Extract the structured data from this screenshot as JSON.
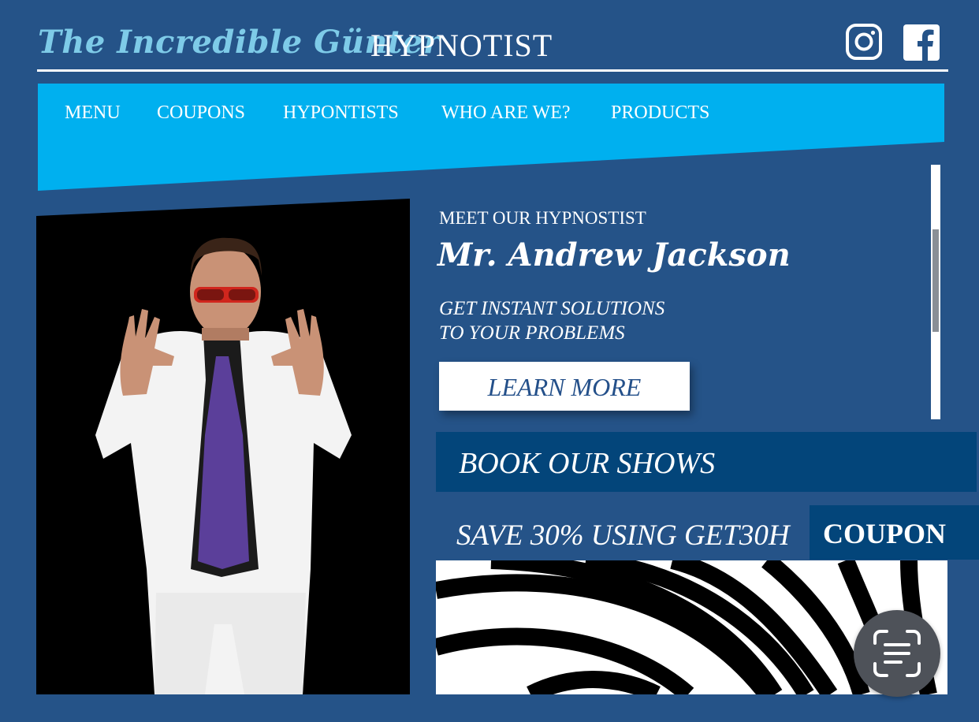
{
  "header": {
    "logo_script": "The Incredible Günter",
    "logo_word": "HYPNOTIST",
    "social": [
      "instagram-icon",
      "facebook-icon"
    ]
  },
  "nav": {
    "items": [
      "MENU",
      "COUPONS",
      "HYPONTISTS",
      "WHO ARE WE?",
      "PRODUCTS"
    ]
  },
  "hero": {
    "kicker": "MEET OUR HYPNOSTIST",
    "name": "Mr. Andrew Jackson",
    "tagline_1": "GET INSTANT SOLUTIONS",
    "tagline_2": "TO YOUR PROBLEMS",
    "cta": "LEARN MORE"
  },
  "shows": {
    "title": "BOOK OUR SHOWS"
  },
  "coupon": {
    "text": "SAVE 30% USING GET30H",
    "label": "COUPON"
  },
  "colors": {
    "background": "#255388",
    "nav_band": "#00b0ef",
    "dark_band": "#03457a",
    "logo_accent": "#7ecbe8"
  },
  "icons": {
    "scan": "text-scan-icon"
  }
}
